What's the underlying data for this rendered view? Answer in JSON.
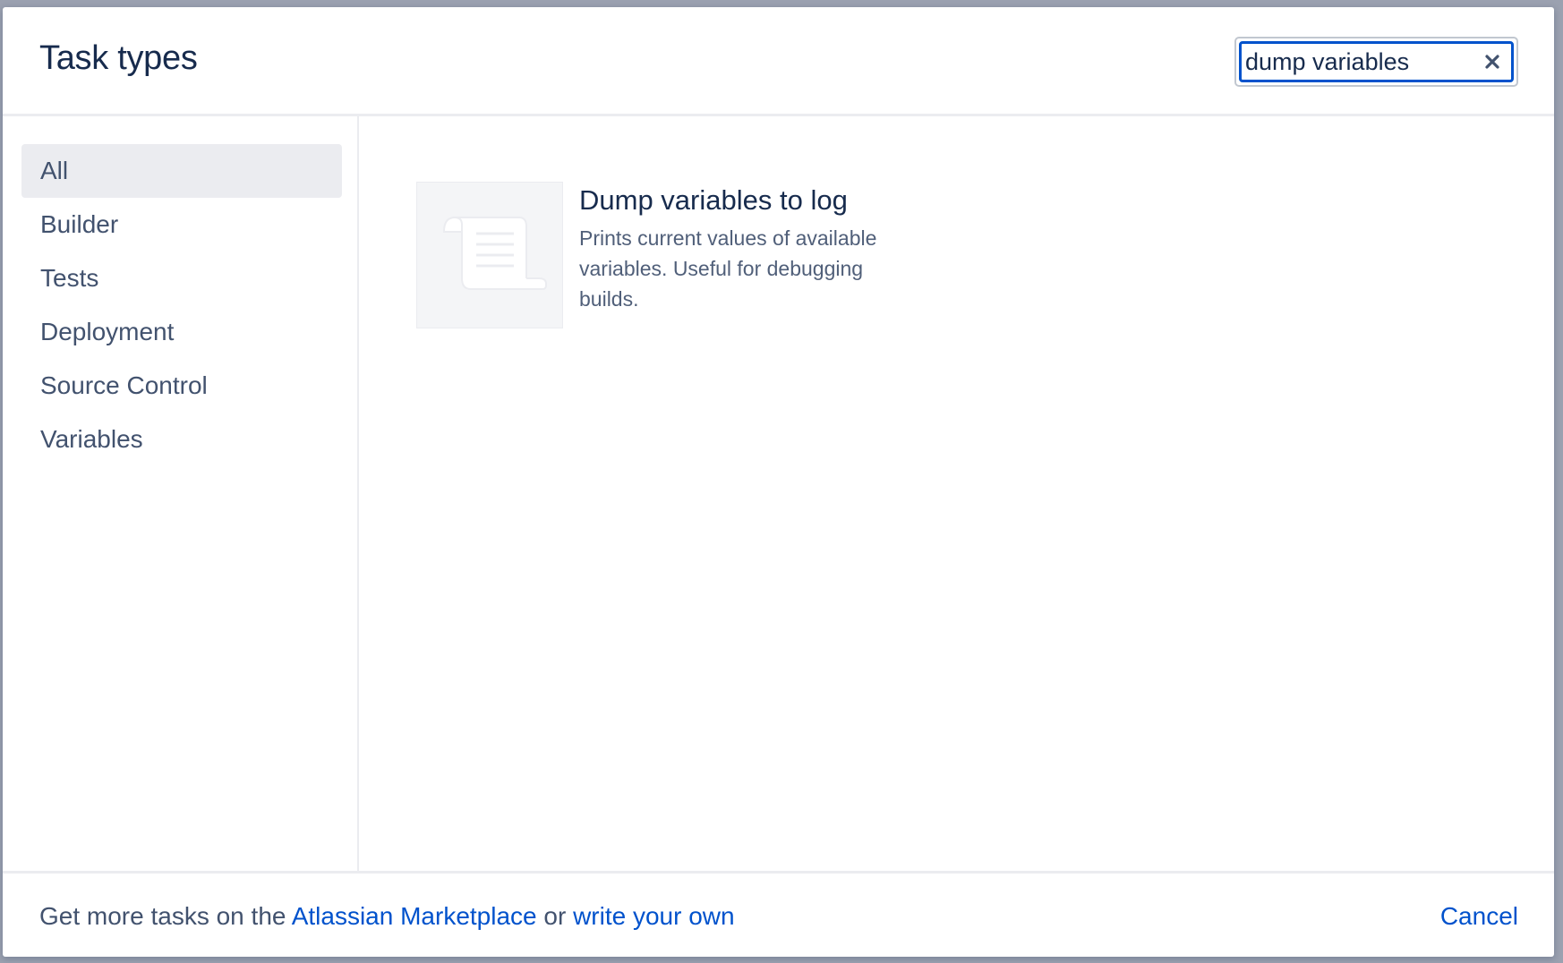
{
  "dialog": {
    "title": "Task types"
  },
  "search": {
    "value": "dump variables",
    "clear_icon": "close-icon"
  },
  "sidebar": {
    "items": [
      {
        "label": "All",
        "active": true
      },
      {
        "label": "Builder",
        "active": false
      },
      {
        "label": "Tests",
        "active": false
      },
      {
        "label": "Deployment",
        "active": false
      },
      {
        "label": "Source Control",
        "active": false
      },
      {
        "label": "Variables",
        "active": false
      }
    ]
  },
  "results": [
    {
      "icon": "script-scroll-icon",
      "title": "Dump variables to log",
      "description": "Prints current values of available variables. Useful for debugging builds."
    }
  ],
  "footer": {
    "text_prefix": "Get more tasks on the ",
    "marketplace_link": "Atlassian Marketplace",
    "text_middle": " or ",
    "write_own_link": "write your own",
    "cancel_label": "Cancel"
  },
  "colors": {
    "accent": "#0052cc",
    "title": "#172b4d",
    "text": "#42526e",
    "active_bg": "#ebecf0",
    "overlay": "#9ba1b0"
  }
}
